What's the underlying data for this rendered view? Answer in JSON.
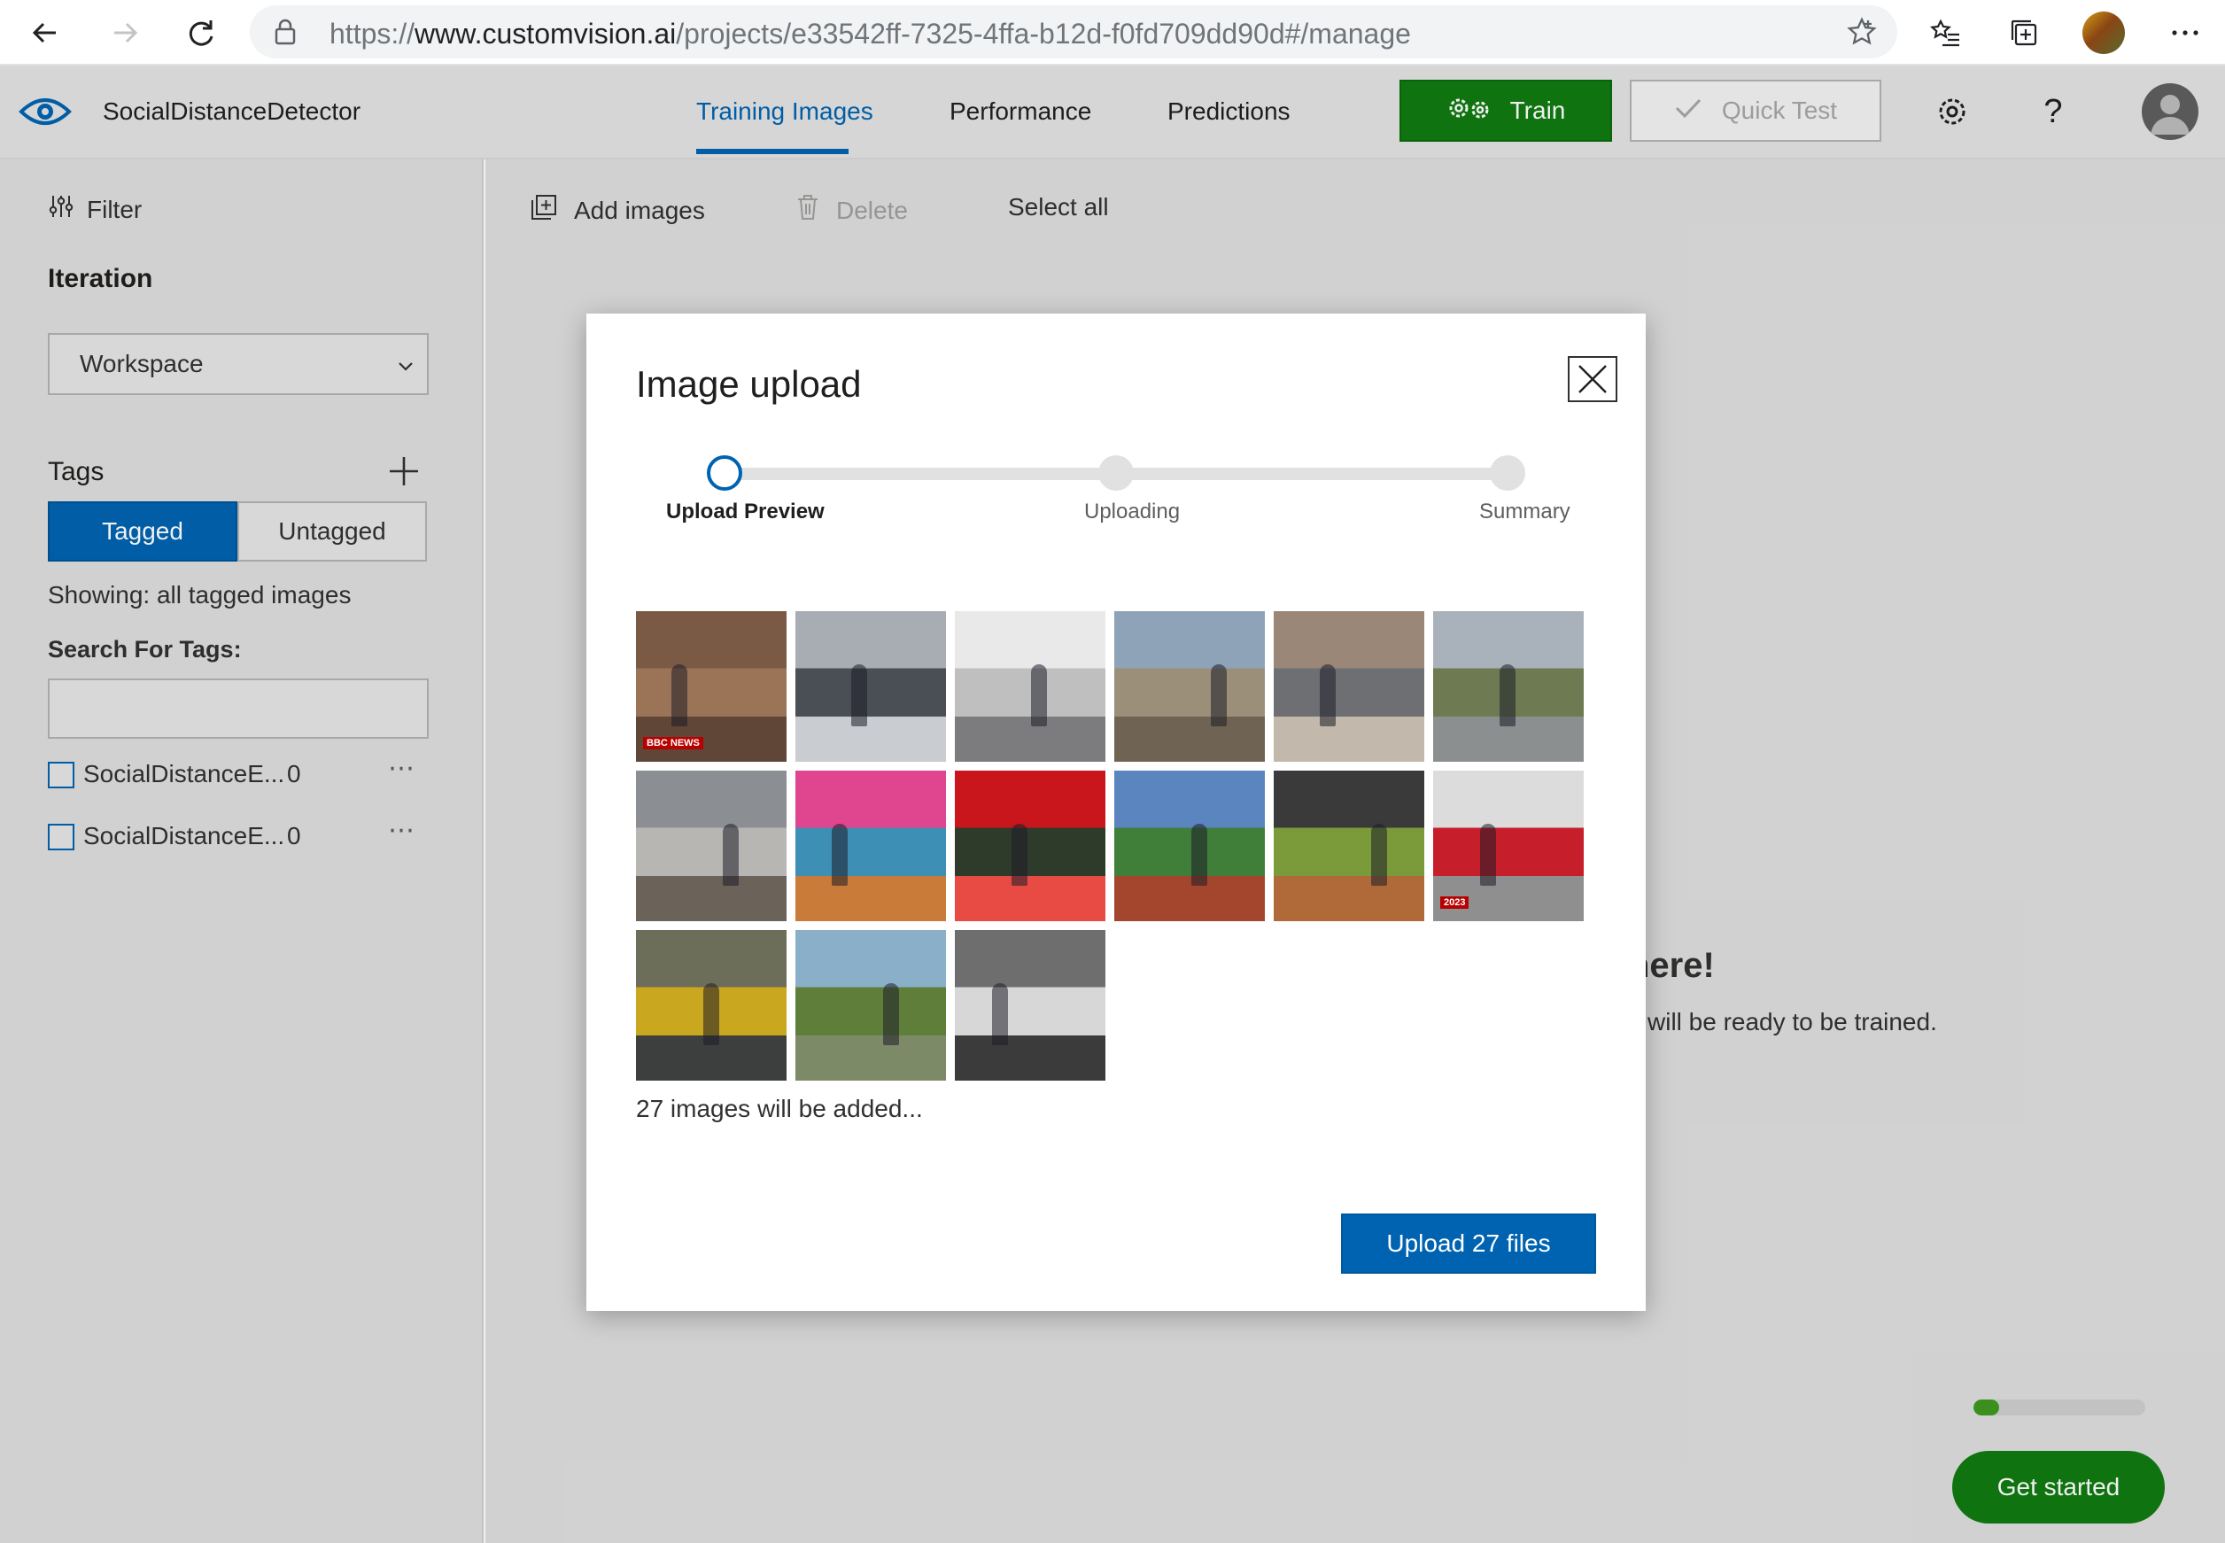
{
  "browser": {
    "url_scheme": "https://",
    "url_host": "www.customvision.ai",
    "url_path": "/projects/e33542ff-7325-4ffa-b12d-f0fd709dd90d#/manage"
  },
  "app": {
    "name": "SocialDistanceDetector",
    "tabs": [
      {
        "label": "Training Images",
        "active": true
      },
      {
        "label": "Performance",
        "active": false
      },
      {
        "label": "Predictions",
        "active": false
      }
    ],
    "train_label": "Train",
    "quick_test_label": "Quick Test",
    "help_glyph": "?",
    "accent_color": "#0063b1",
    "train_color": "#107c10"
  },
  "sidebar": {
    "filter_label": "Filter",
    "iteration_label": "Iteration",
    "iteration_value": "Workspace",
    "tags_label": "Tags",
    "tagged_label": "Tagged",
    "untagged_label": "Untagged",
    "showing_text": "Showing: all tagged images",
    "search_label": "Search For Tags:",
    "search_value": "",
    "tag_items": [
      {
        "name": "SocialDistanceE...",
        "count": "0"
      },
      {
        "name": "SocialDistanceE...",
        "count": "0"
      }
    ]
  },
  "toolbar": {
    "add_images_label": "Add images",
    "delete_label": "Delete",
    "select_all_label": "Select all"
  },
  "background": {
    "heading_fragment": "nere!",
    "sub_fragment": "will be ready to be trained.",
    "progress_fraction": 0.15,
    "get_started_label": "Get started"
  },
  "modal": {
    "title": "Image upload",
    "steps": [
      {
        "label": "Upload Preview",
        "state": "active"
      },
      {
        "label": "Uploading",
        "state": "todo"
      },
      {
        "label": "Summary",
        "state": "todo"
      }
    ],
    "thumbnails": [
      {
        "name": "thumb-brick-wall-bench",
        "colors": [
          "#7a5a44",
          "#9b7457",
          "#5f4636"
        ],
        "badge": "BBC NEWS"
      },
      {
        "name": "thumb-store-queue",
        "colors": [
          "#a8adb3",
          "#4a4f55",
          "#c9ccd0"
        ]
      },
      {
        "name": "thumb-storefront-line",
        "colors": [
          "#e9e9ea",
          "#bfbfc0",
          "#7c7c7e"
        ]
      },
      {
        "name": "thumb-man-outdoors",
        "colors": [
          "#8ea3b8",
          "#9c8f7a",
          "#6f6453"
        ]
      },
      {
        "name": "thumb-woman-cart",
        "colors": [
          "#9a8778",
          "#6d6f73",
          "#c3b8ac"
        ]
      },
      {
        "name": "thumb-suburb-street",
        "colors": [
          "#a9b2ba",
          "#6e7a52",
          "#8c8f90"
        ]
      },
      {
        "name": "thumb-park-walker",
        "colors": [
          "#8b8f94",
          "#b8b6b2",
          "#6b6259"
        ]
      },
      {
        "name": "thumb-tv-studio",
        "colors": [
          "#e0468f",
          "#3e8fb6",
          "#c97b3a"
        ]
      },
      {
        "name": "thumb-strawberries",
        "colors": [
          "#c8161c",
          "#2f3b2a",
          "#e84b43"
        ]
      },
      {
        "name": "thumb-sports-field",
        "colors": [
          "#5a85bf",
          "#3f7f3a",
          "#a4462e"
        ]
      },
      {
        "name": "thumb-grocery-store",
        "colors": [
          "#3a3a3a",
          "#7b9a3a",
          "#b06a3a"
        ]
      },
      {
        "name": "thumb-red-jersey",
        "colors": [
          "#dcdcdc",
          "#c71e2b",
          "#8f8f8f"
        ],
        "badge": "2023"
      },
      {
        "name": "thumb-road-cones",
        "colors": [
          "#6d6e5a",
          "#c9a71e",
          "#3d3f3f"
        ]
      },
      {
        "name": "thumb-park-exercise",
        "colors": [
          "#8ab0c9",
          "#5f7e3a",
          "#7d8a68"
        ]
      },
      {
        "name": "thumb-crosswalk",
        "colors": [
          "#6e6e6e",
          "#d7d7d7",
          "#3b3b3b"
        ]
      }
    ],
    "count_text": "27 images will be added...",
    "upload_label": "Upload 27 files"
  }
}
